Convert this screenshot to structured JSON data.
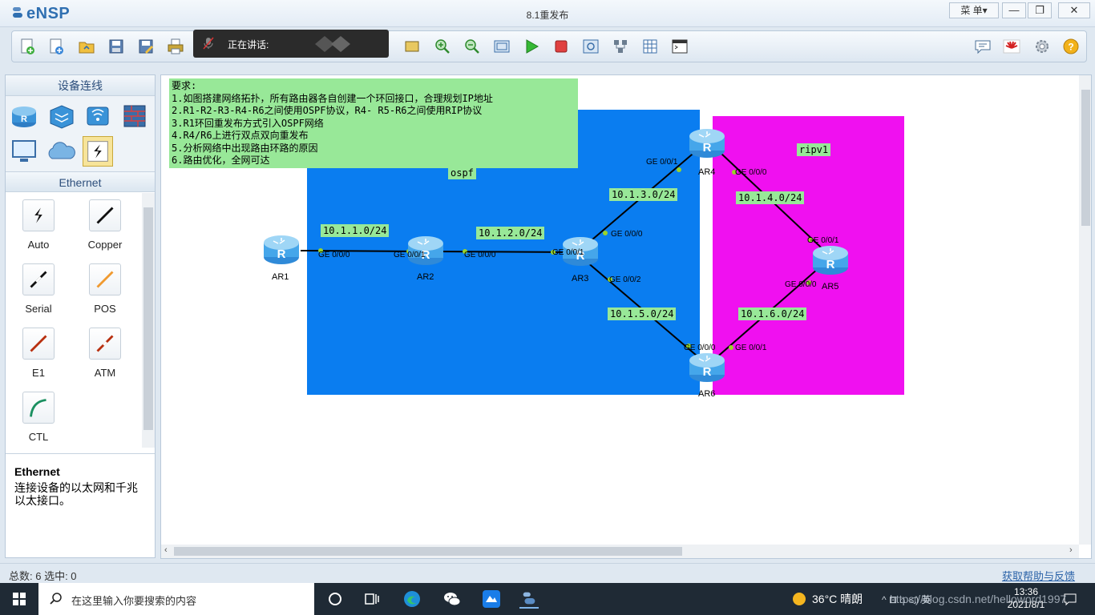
{
  "app": {
    "logo": "eNSP",
    "window_title": "8.1重发布",
    "menu_label": "菜 单",
    "menu_arrow": "▾",
    "win_min": "—",
    "win_max": "❐",
    "win_close": "✕"
  },
  "speaking": {
    "label": "正在讲话:"
  },
  "toolbar": {
    "icons": [
      "new-topology-icon",
      "new-lab-icon",
      "open-icon",
      "save-icon",
      "save-as-icon",
      "print-icon",
      "undo-icon",
      "redo-icon",
      "select-icon",
      "move-icon",
      "delete-icon",
      "delete-all-icon",
      "text-icon",
      "rectangle-icon",
      "zoom-in-icon",
      "zoom-out-icon",
      "fit-icon",
      "start-device-icon",
      "stop-device-icon",
      "capture-icon",
      "topology-icon",
      "grid-icon",
      "cli-icon",
      "chat-icon",
      "huawei-icon",
      "settings-icon",
      "help-icon"
    ]
  },
  "left_panel": {
    "title": "设备连线",
    "devices": [
      "router-icon",
      "switch-icon",
      "wireless-icon",
      "firewall-icon",
      "pc-icon",
      "cloud-icon",
      "connection-icon"
    ],
    "ethernet_header": "Ethernet",
    "cables": [
      {
        "name": "Auto",
        "icon": "auto-cable-icon"
      },
      {
        "name": "Copper",
        "icon": "copper-cable-icon"
      },
      {
        "name": "Serial",
        "icon": "serial-cable-icon"
      },
      {
        "name": "POS",
        "icon": "pos-cable-icon"
      },
      {
        "name": "E1",
        "icon": "e1-cable-icon"
      },
      {
        "name": "ATM",
        "icon": "atm-cable-icon"
      },
      {
        "name": "CTL",
        "icon": "ctl-cable-icon"
      }
    ],
    "desc_title": "Ethernet",
    "desc_text": "连接设备的以太网和千兆以太接口。"
  },
  "canvas": {
    "requirements": [
      "要求:",
      "1.如图搭建网络拓扑，所有路由器各自创建一个环回接口，合理规划IP地址",
      "2.R1-R2-R3-R4-R6之间使用OSPF协议，R4- R5-R6之间使用RIP协议",
      "3.R1环回重发布方式引入OSPF网络",
      "4.R4/R6上进行双点双向重发布",
      "5.分析网络中出现路由环路的原因",
      "6.路由优化，全网可达"
    ],
    "area_colors": {
      "ospf": "#0a7df0",
      "rip": "#f010f0"
    },
    "area_labels": {
      "ospf": "ospf",
      "rip": "ripv1"
    },
    "routers": [
      "AR1",
      "AR2",
      "AR3",
      "AR4",
      "AR5",
      "AR6"
    ],
    "subnets": [
      "10.1.1.0/24",
      "10.1.2.0/24",
      "10.1.3.0/24",
      "10.1.4.0/24",
      "10.1.5.0/24",
      "10.1.6.0/24"
    ],
    "ports": {
      "ar1_ge0": "GE 0/0/0",
      "ar2_ge1": "GE 0/0/1",
      "ar2_ge0": "GE 0/0/0",
      "ar3_ge1": "GE 0/0/1",
      "ar3_ge0": "GE 0/0/0",
      "ar3_ge2": "GE 0/0/2",
      "ar4_ge1": "GE 0/0/1",
      "ar4_ge0": "GE 0/0/0",
      "ar5_ge1": "GE 0/0/1",
      "ar5_ge0": "GE 0/0/0",
      "ar6_ge0": "GE 0/0/0",
      "ar6_ge1": "GE 0/0/1"
    }
  },
  "status": {
    "left": "总数: 6  选中: 0",
    "right": "获取帮助与反馈"
  },
  "taskbar": {
    "search_placeholder": "在这里输入你要搜索的内容",
    "weather": "36°C  晴朗",
    "tray": "^  ⊡  ⌂  ◁)  英",
    "time": "13:36",
    "date": "2021/8/1",
    "watermark": "https://blog.csdn.net/helloword1997",
    "apps": [
      "task-view-icon",
      "edge-icon",
      "wechat-icon",
      "tencent-meeting-icon",
      "ensp-icon"
    ]
  }
}
